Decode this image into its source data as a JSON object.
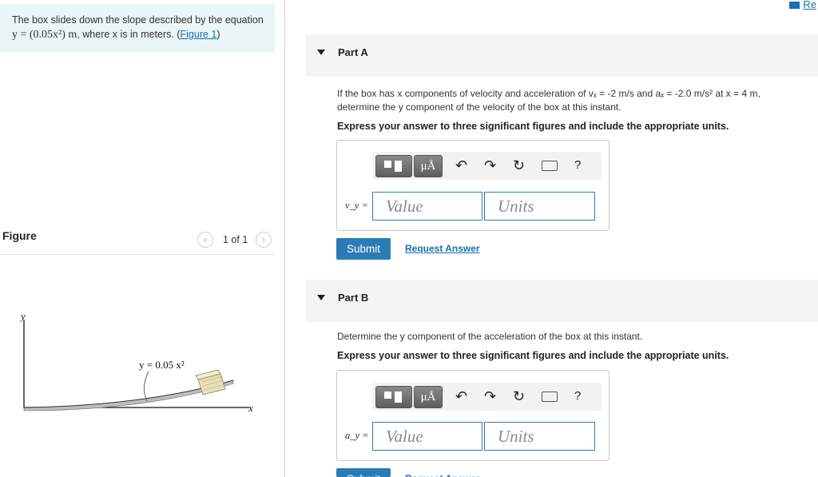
{
  "intro": {
    "text1": "The box slides down the slope described by the equation",
    "eq_prefix": "y = (0.05x²) m",
    "eq_suffix": ", where x is in meters. (",
    "figure_link": "Figure 1",
    "close_paren": ")"
  },
  "figure": {
    "label": "Figure",
    "pager": "1 of 1",
    "axis_y": "y",
    "axis_x": "x",
    "curve_label": "y = 0.05 x²"
  },
  "top_right": {
    "link": "Re"
  },
  "toolbar": {
    "template_icon": "template-icon",
    "units_symbol": "μÅ",
    "undo_icon": "undo-icon",
    "redo_icon": "redo-icon",
    "reset_icon": "reset-icon",
    "keyboard_icon": "keyboard-icon",
    "help": "?"
  },
  "partA": {
    "title": "Part A",
    "question_1": "If the box has x components of velocity and acceleration of vₓ = -2 m/s and aₓ = -2.0 m/s² at x = 4 m,",
    "question_2": "determine the y component of the velocity of the box at this instant.",
    "instruction": "Express your answer to three significant figures and include the appropriate units.",
    "var_label": "v_y =",
    "value_placeholder": "Value",
    "units_placeholder": "Units",
    "submit": "Submit",
    "request": "Request Answer"
  },
  "partB": {
    "title": "Part B",
    "question_1": "Determine the y component of the acceleration of the box at this instant.",
    "instruction": "Express your answer to three significant figures and include the appropriate units.",
    "var_label": "a_y =",
    "value_placeholder": "Value",
    "units_placeholder": "Units",
    "submit": "Submit",
    "request": "Request Answer"
  }
}
